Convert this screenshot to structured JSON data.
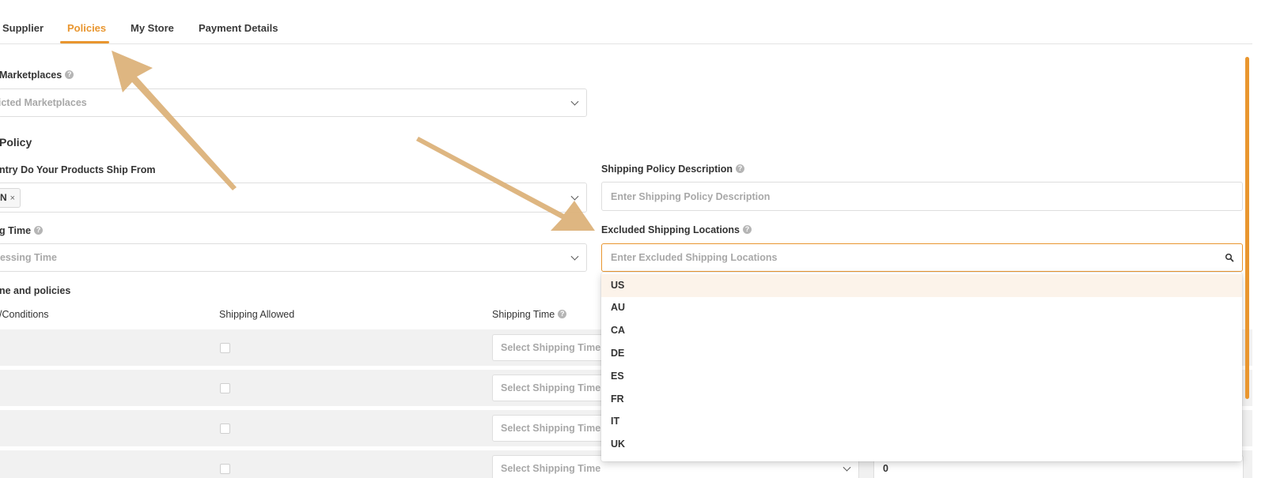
{
  "tabs": [
    {
      "label": "Supplier",
      "active": false
    },
    {
      "label": "Policies",
      "active": true
    },
    {
      "label": "My Store",
      "active": false
    },
    {
      "label": "Payment Details",
      "active": false
    }
  ],
  "restricted_marketplaces": {
    "label": "Marketplaces",
    "placeholder": "ricted Marketplaces"
  },
  "shipping_policy": {
    "section_title": "Policy",
    "ship_from": {
      "label": "ntry Do Your Products Ship From",
      "chip": "N",
      "chip_remove": "×"
    },
    "description": {
      "label": "Shipping Policy Description",
      "placeholder": "Enter Shipping Policy Description"
    },
    "processing_time": {
      "label": "g Time",
      "placeholder": "cessing Time"
    },
    "excluded_locations": {
      "label": "Excluded Shipping Locations",
      "placeholder": "Enter Excluded Shipping Locations",
      "options": [
        "US",
        "AU",
        "CA",
        "DE",
        "ES",
        "FR",
        "IT",
        "UK"
      ],
      "highlighted": "US"
    }
  },
  "time_and_policies": {
    "section_title": "ne and policies",
    "columns": [
      "/Conditions",
      "Shipping Allowed",
      "Shipping Time"
    ],
    "rows": [
      {
        "shipping_time_placeholder": "Select Shipping Time"
      },
      {
        "shipping_time_placeholder": "Select Shipping Time"
      },
      {
        "shipping_time_placeholder": "Select Shipping Time"
      },
      {
        "shipping_time_placeholder": "Select Shipping Time",
        "value": "0"
      }
    ]
  },
  "colors": {
    "accent": "#e9962f",
    "annotation_arrow": "#dcb27a",
    "highlight_row": "#fcf3ea"
  }
}
